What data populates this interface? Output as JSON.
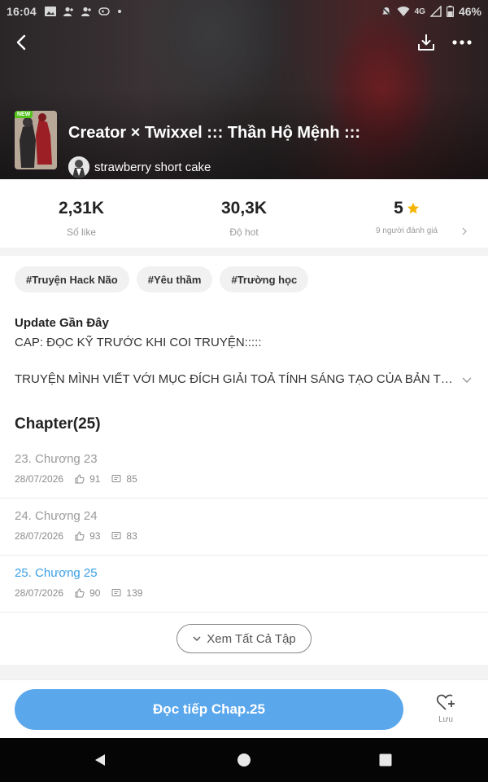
{
  "status_bar": {
    "time": "16:04",
    "network": "4G",
    "battery": "46%"
  },
  "story": {
    "badge": "NEW",
    "title": "Creator × Twixxel ::: Thần Hộ Mệnh :::",
    "author": "strawberry short cake"
  },
  "stats": {
    "likes": {
      "value": "2,31K",
      "label": "Số like"
    },
    "hot": {
      "value": "30,3K",
      "label": "Độ hot"
    },
    "rating": {
      "value": "5",
      "label": "9 người đánh giá"
    }
  },
  "tags": [
    "#Truyện Hack Não",
    "#Yêu thầm",
    "#Trường học"
  ],
  "update": {
    "title": "Update Gần Đây",
    "text": "CAP: ĐỌC KỸ TRƯỚC KHI COI TRUYỆN:::::"
  },
  "description": "TRUYỆN MÌNH VIẾT VỚI MỤC ĐÍCH GIẢI TOẢ TÍNH SÁNG TẠO CỦA BẢN THÂN",
  "chapters": {
    "heading": "Chapter(25)",
    "items": [
      {
        "title": "23. Chương 23",
        "date": "28/07/2026",
        "likes": "91",
        "comments": "85",
        "current": false
      },
      {
        "title": "24. Chương 24",
        "date": "28/07/2026",
        "likes": "93",
        "comments": "83",
        "current": false
      },
      {
        "title": "25. Chương 25",
        "date": "28/07/2026",
        "likes": "90",
        "comments": "139",
        "current": true
      }
    ],
    "see_all": "Xem Tất Cả Tập"
  },
  "bottom": {
    "read_button": "Đọc tiếp Chap.25",
    "save_label": "Lưu"
  },
  "colors": {
    "accent": "#5aa7ec",
    "current_chapter": "#3aa0e8",
    "star": "#f5b400"
  }
}
